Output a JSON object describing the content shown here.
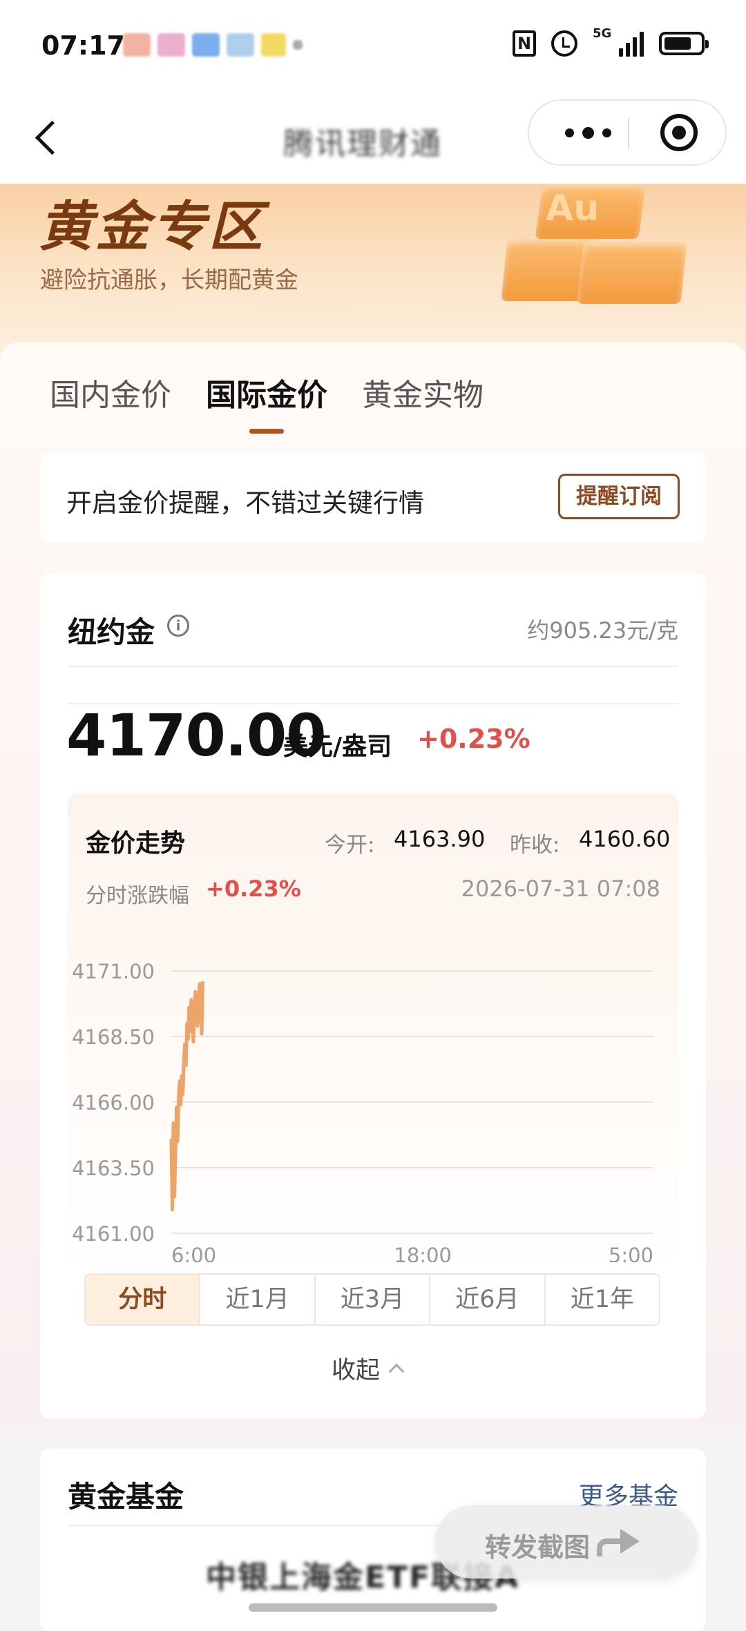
{
  "status_bar": {
    "time": "07:17",
    "nfc_icon": "N",
    "network": "5G"
  },
  "nav": {
    "title": "腾讯理财通"
  },
  "banner": {
    "title": "黄金专区",
    "subtitle": "避险抗通胀，长期配黄金",
    "icon_text": "Au"
  },
  "tabs": [
    {
      "label": "国内金价",
      "active": false
    },
    {
      "label": "国际金价",
      "active": true
    },
    {
      "label": "黄金实物",
      "active": false
    }
  ],
  "alert": {
    "text": "开启金价提醒，不错过关键行情",
    "button": "提醒订阅"
  },
  "quote": {
    "name": "纽约金",
    "info_icon": "i",
    "per_gram": "约905.23元/克",
    "price": "4170.00",
    "unit": "美元/盎司",
    "change": "+0.23%"
  },
  "trend": {
    "title": "金价走势",
    "open_label": "今开:",
    "open_value": "4163.90",
    "prev_close_label": "昨收:",
    "prev_close_value": "4160.60",
    "intraday_label": "分时涨跌幅",
    "intraday_value": "+0.23%",
    "timestamp": "2026-07-31 07:08"
  },
  "chart_data": {
    "type": "line",
    "title": "",
    "xlabel": "",
    "ylabel": "",
    "ylim": [
      4161.0,
      4171.0
    ],
    "y_ticks": [
      "4171.00",
      "4168.50",
      "4166.00",
      "4163.50",
      "4161.00"
    ],
    "x_ticks": [
      "6:00",
      "18:00",
      "5:00"
    ],
    "grid": true,
    "line_color": "#eda468",
    "series": [
      {
        "x_hours": [
          0,
          0.05,
          0.1,
          0.15,
          0.2,
          0.25,
          0.3,
          0.35,
          0.4,
          0.45,
          0.5,
          0.55,
          0.6,
          0.65,
          0.7,
          0.75,
          0.8,
          0.85,
          0.9,
          0.95,
          1.0,
          1.05,
          1.1,
          1.15,
          1.2,
          1.25,
          1.3,
          1.35,
          1.4,
          1.45,
          1.5
        ],
        "values": [
          4164.6,
          4161.9,
          4165.2,
          4162.4,
          4164.1,
          4165.8,
          4164.5,
          4166.1,
          4166.8,
          4165.9,
          4167.0,
          4166.3,
          4167.6,
          4168.2,
          4167.4,
          4169.0,
          4168.4,
          4169.6,
          4168.7,
          4169.9,
          4169.1,
          4168.3,
          4169.5,
          4170.2,
          4169.4,
          4168.9,
          4169.7,
          4170.5,
          4169.6,
          4168.6,
          4170.6
        ]
      }
    ]
  },
  "range_tabs": [
    {
      "label": "分时",
      "active": true
    },
    {
      "label": "近1月",
      "active": false
    },
    {
      "label": "近3月",
      "active": false
    },
    {
      "label": "近6月",
      "active": false
    },
    {
      "label": "近1年",
      "active": false
    }
  ],
  "collapse_label": "收起",
  "funds": {
    "title": "黄金基金",
    "more": "更多基金",
    "first_fund": "中银上海金ETF联接A"
  },
  "share_label": "转发截图"
}
